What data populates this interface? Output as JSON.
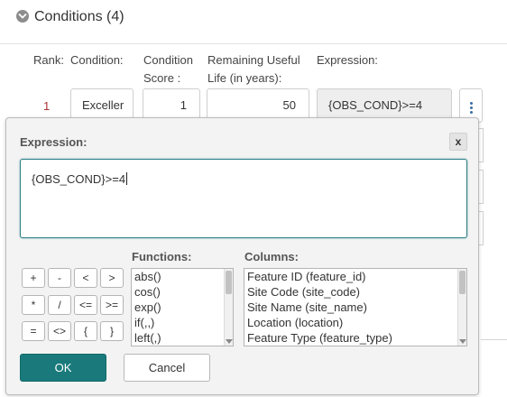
{
  "section": {
    "title": "Conditions (4)"
  },
  "table": {
    "headers": {
      "rank": "Rank:",
      "condition": "Condition:",
      "score_line1": "Condition",
      "score_line2": "Score :",
      "life_line1": "Remaining Useful",
      "life_line2": "Life (in years):",
      "expression": "Expression:"
    },
    "row1": {
      "rank": "1",
      "condition": "Exceller",
      "score": "1",
      "life": "50",
      "expression": "{OBS_COND}>=4"
    }
  },
  "dialog": {
    "title": "Expression:",
    "close_label": "x",
    "expression_value": "{OBS_COND}>=4",
    "operators": [
      "+",
      "-",
      "<",
      ">",
      "*",
      "/",
      "<=",
      ">=",
      "=",
      "<>",
      "{",
      "}"
    ],
    "functions_label": "Functions:",
    "functions": [
      "abs()",
      "cos()",
      "exp()",
      "if(,,)",
      "left(,)"
    ],
    "columns_label": "Columns:",
    "columns": [
      "Feature ID (feature_id)",
      "Site Code (site_code)",
      "Site Name (site_name)",
      "Location (location)",
      "Feature Type (feature_type)"
    ],
    "ok_label": "OK",
    "cancel_label": "Cancel"
  },
  "colors": {
    "accent": "#1a7a7b",
    "rank_text": "#aa3333",
    "kebab": "#3a6ea5"
  }
}
